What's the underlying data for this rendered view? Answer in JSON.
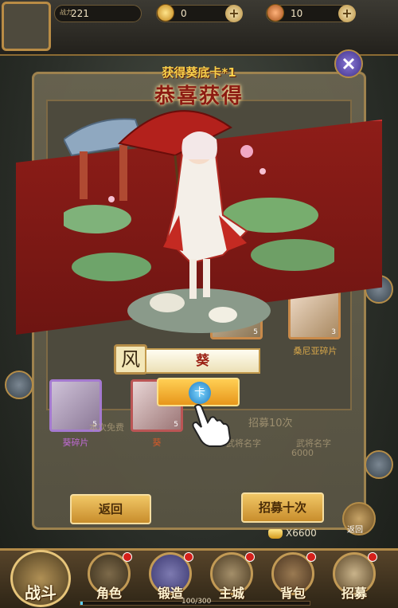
{
  "topbar": {
    "power_label": "战力",
    "power_value": "221",
    "gold_value": "0",
    "copper_value": "10"
  },
  "reward": {
    "acquired_text": "获得葵底卡*1",
    "title_text": "恭喜获得",
    "element": "风",
    "hero_name": "葵",
    "confirm_glyph": "卡"
  },
  "background_cards": [
    {
      "label": "葵碎片",
      "count": "5"
    },
    {
      "label": "葵",
      "count": "5"
    },
    {
      "label": "桑尼亚碎片",
      "count": "3"
    },
    {
      "label": "",
      "count": "5"
    }
  ],
  "faded": {
    "recruit_once_hint": "本次免费",
    "recruit_ten_top": "招募10次",
    "name_placeholder_1": "武将名字",
    "name_placeholder_2": "武将名字",
    "cost_small": "6000"
  },
  "buttons": {
    "back": "返回",
    "recruit_ten": "招募十次",
    "right_back": "返回"
  },
  "cost": {
    "amount": "X6600"
  },
  "nav": {
    "battle": "战斗",
    "items": [
      {
        "label": "角色"
      },
      {
        "label": "锻造"
      },
      {
        "label": "主城"
      },
      {
        "label": "背包"
      },
      {
        "label": "招募"
      }
    ],
    "xp_text": "100/300"
  },
  "colors": {
    "band_red": "#8e1d18",
    "gold_button": "#e7961b",
    "notification_dot": "#d4201b"
  }
}
